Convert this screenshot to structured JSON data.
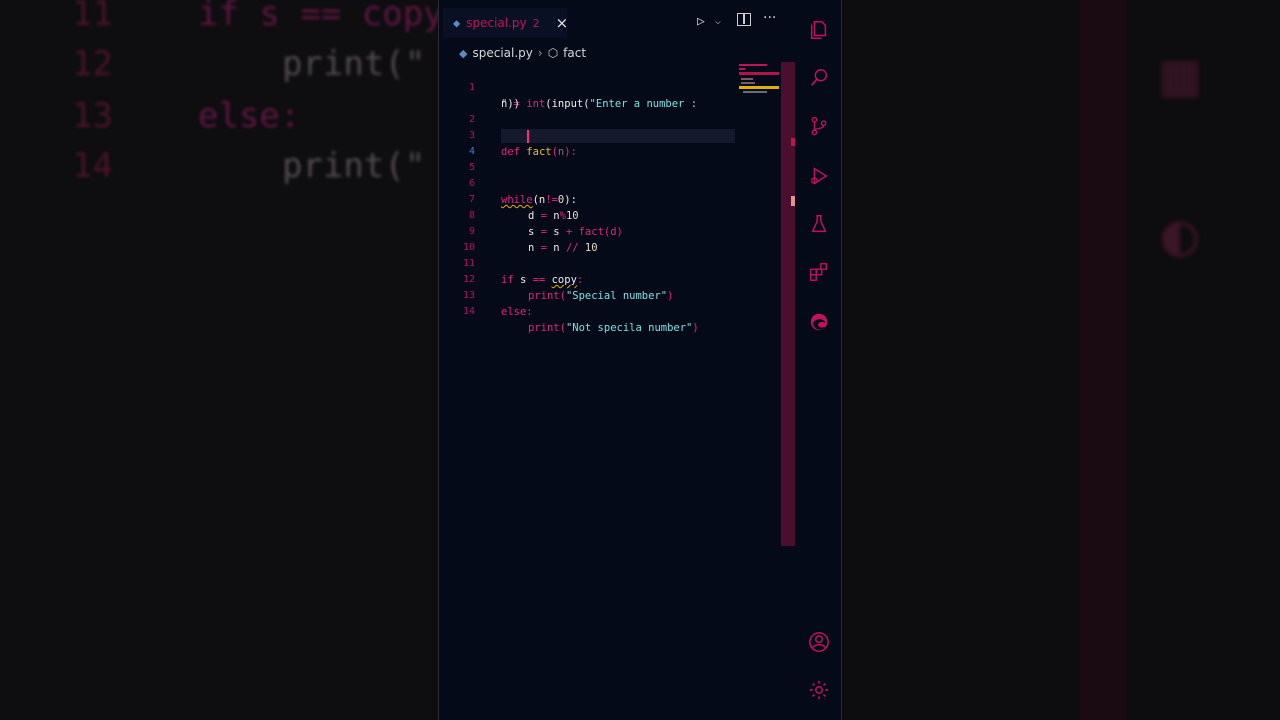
{
  "background_code": {
    "lines": [
      {
        "num": "11",
        "text": "if s == copy"
      },
      {
        "num": "12",
        "text": "print(\""
      },
      {
        "num": "13",
        "text": "else:"
      },
      {
        "num": "14",
        "text": "print(\""
      }
    ]
  },
  "tab": {
    "label": "special.py",
    "problems": "2",
    "close": "×"
  },
  "toolbar": {
    "run": "▷",
    "run_options": "⌵",
    "more": "···"
  },
  "breadcrumb": {
    "file": "special.py",
    "separator": "›",
    "symbol": "fact"
  },
  "editor": {
    "active_line": 4,
    "line_numbers": [
      "1",
      "",
      "2",
      "3",
      "4",
      "5",
      "6",
      "7",
      "8",
      "9",
      "10",
      "11",
      "12",
      "13",
      "14"
    ],
    "line1a_a": "n ",
    "line1a_op": "=",
    "line1a_b": " ",
    "line1a_fn": "int",
    "line1a_c": "(input(",
    "line1a_str": "\"Enter a number :",
    "line1b_str": "\"",
    "line1b_end": "))",
    "line3_kw": "def",
    "line3_fn": "fact",
    "line3_p1": "(",
    "line3_param": "n",
    "line3_p2": "):",
    "line6_kw": "while",
    "line6_a": "(n",
    "line6_op": "!=",
    "line6_num": "0",
    "line6_b": "):",
    "line7_a": "d ",
    "line7_op": "=",
    "line7_b": " n",
    "line7_op2": "%",
    "line7_num": "10",
    "line8_a": "s ",
    "line8_op": "=",
    "line8_b": " s ",
    "line8_op2": "+",
    "line8_fn": " fact",
    "line8_c": "(d)",
    "line9_a": "n ",
    "line9_op": "=",
    "line9_b": " n ",
    "line9_op2": "//",
    "line9_num": " 10",
    "line11_kw": "if",
    "line11_a": " s ",
    "line11_op": "==",
    "line11_b": " ",
    "line11_var": "copy",
    "line11_c": ":",
    "line12_fn": "print",
    "line12_a": "(",
    "line12_str": "\"Special number\"",
    "line12_b": ")",
    "line13_kw": "else",
    "line13_c": ":",
    "line14_fn": "print",
    "line14_a": "(",
    "line14_str": "\"Not specila number\"",
    "line14_b": ")"
  },
  "activity_bar": {
    "items": [
      {
        "icon": "explorer-icon"
      },
      {
        "icon": "search-icon"
      },
      {
        "icon": "source-control-icon"
      },
      {
        "icon": "run-debug-icon"
      },
      {
        "icon": "testing-icon"
      },
      {
        "icon": "extensions-icon"
      },
      {
        "icon": "edge-icon"
      }
    ],
    "bottom": [
      {
        "icon": "account-icon"
      },
      {
        "icon": "settings-gear-icon"
      }
    ]
  },
  "colors": {
    "accent": "#e0267e",
    "background": "#050a18",
    "scrollbar": "#4a0f2e"
  }
}
